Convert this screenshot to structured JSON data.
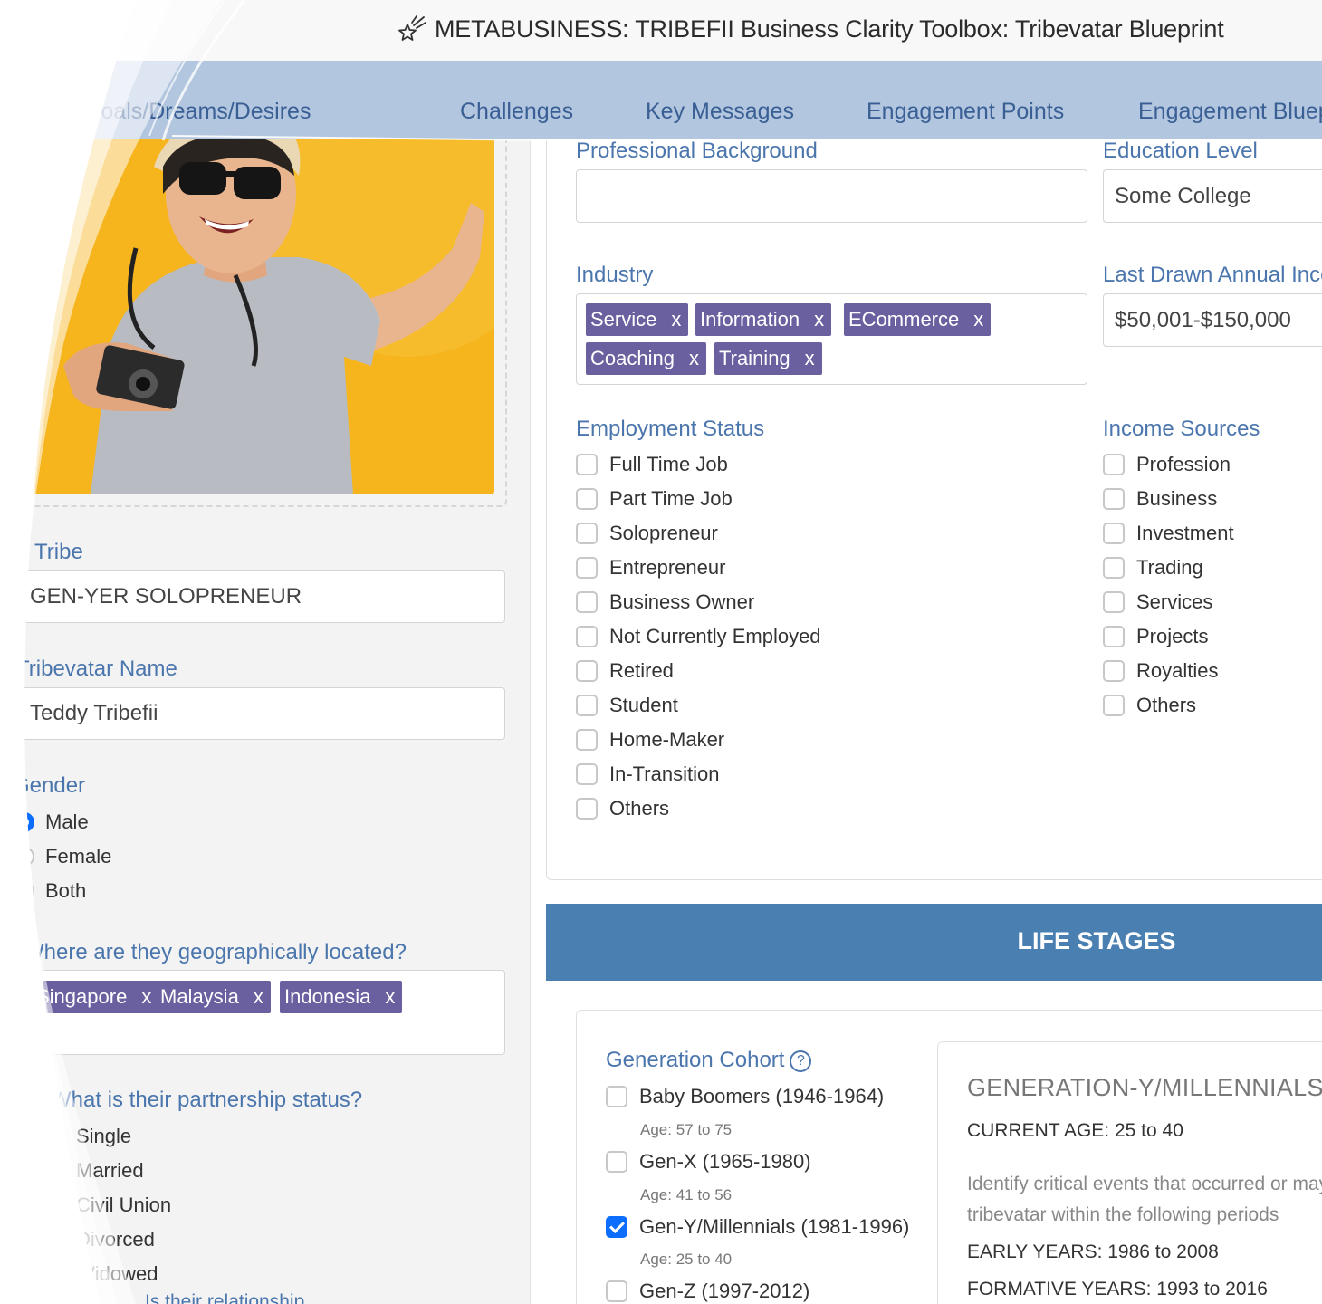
{
  "app": {
    "title": "METABUSINESS: TRIBEFII Business Clarity Toolbox: Tribevatar Blueprint",
    "icon": "sparkle-star-icon"
  },
  "nav": {
    "tabs": [
      {
        "label": "Goals/Dreams/Desires"
      },
      {
        "label": "Challenges"
      },
      {
        "label": "Key Messages"
      },
      {
        "label": "Engagement Points"
      },
      {
        "label": "Engagement Blueprint"
      }
    ]
  },
  "left": {
    "tribe_label": "Tribe",
    "tribe_value": "GEN-YER SOLOPRENEUR",
    "name_label": "Tribevatar Name",
    "name_value": "Teddy Tribefii",
    "gender_label": "Gender",
    "gender_options": [
      "Male",
      "Female",
      "Both"
    ],
    "gender_selected": "Male",
    "location_label": "Where are they geographically located?",
    "location_tags": [
      "Singapore",
      "Malaysia",
      "Indonesia"
    ],
    "partnership_label": "What is their partnership status?",
    "partnership_options": [
      "Single",
      "Married",
      "Civil Union",
      "Divorced",
      "Widowed"
    ],
    "next_label": "Is their relationship"
  },
  "right": {
    "prof_label": "Professional Background",
    "prof_value": "",
    "edu_label": "Education Level",
    "edu_value": "Some College",
    "industry_label": "Industry",
    "industry_tags": [
      "Service",
      "Information",
      "ECommerce",
      "Coaching",
      "Training"
    ],
    "income_label": "Last Drawn Annual Income",
    "income_value": "$50,001-$150,000",
    "employment_label": "Employment Status",
    "employment_options": [
      "Full Time Job",
      "Part Time Job",
      "Solopreneur",
      "Entrepreneur",
      "Business Owner",
      "Not Currently Employed",
      "Retired",
      "Student",
      "Home-Maker",
      "In-Transition",
      "Others"
    ],
    "sources_label": "Income Sources",
    "sources_options": [
      "Profession",
      "Business",
      "Investment",
      "Trading",
      "Services",
      "Projects",
      "Royalties",
      "Others"
    ]
  },
  "life": {
    "title": "LIFE STAGES",
    "cohort_label": "Generation Cohort",
    "cohorts": [
      {
        "label": "Baby Boomers (1946-1964)",
        "age": "Age: 57 to 75",
        "checked": false
      },
      {
        "label": "Gen-X (1965-1980)",
        "age": "Age: 41 to 56",
        "checked": false
      },
      {
        "label": "Gen-Y/Millennials (1981-1996)",
        "age": "Age: 25 to 40",
        "checked": true
      },
      {
        "label": "Gen-Z (1997-2012)",
        "age": "",
        "checked": false
      }
    ],
    "mill_title": "GENERATION-Y/MILLENNIALS",
    "current_age": "CURRENT AGE: 25 to 40",
    "identify_line1": "Identify critical events that occurred or may",
    "identify_line2": "tribevatar within the following periods",
    "early_years": "EARLY YEARS: 1986 to 2008",
    "formative_years": "FORMATIVE YEARS: 1993 to 2016"
  },
  "colors": {
    "nav_bg": "#b2c6df",
    "label_blue": "#4b76ad",
    "tag_purple": "#6a5f9f",
    "band_blue": "#4a7fb2",
    "check_blue": "#0d6efd",
    "photo_yellow": "#f6b41d"
  }
}
